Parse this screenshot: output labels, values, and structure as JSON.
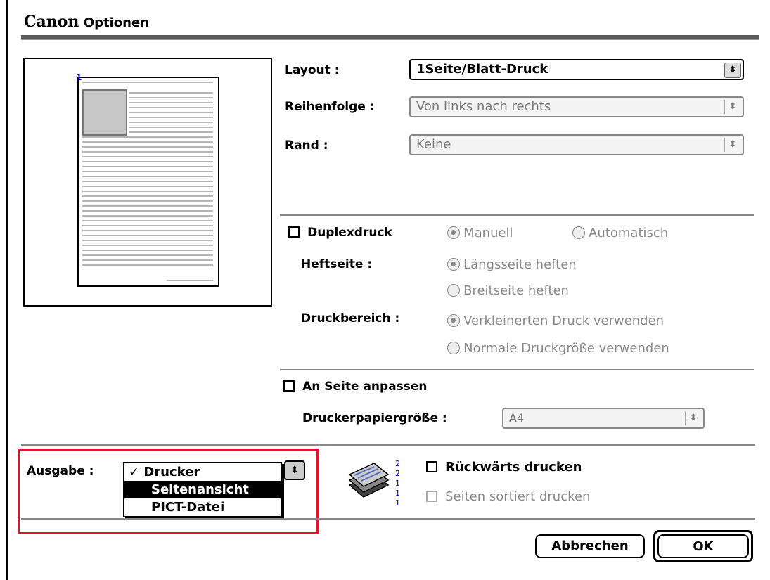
{
  "window": {
    "brand": "Canon",
    "title": "Optionen"
  },
  "layout": {
    "layout_label": "Layout :",
    "layout_value": "1Seite/Blatt-Druck",
    "order_label": "Reihenfolge :",
    "order_value": "Von links nach rechts",
    "border_label": "Rand :",
    "border_value": "Keine",
    "preview_page_number": "1"
  },
  "duplex": {
    "checkbox_label": "Duplexdruck",
    "mode_manual": "Manuell",
    "mode_auto": "Automatisch",
    "binding_label": "Heftseite :",
    "binding_long": "Längsseite heften",
    "binding_short": "Breitseite heften",
    "area_label": "Druckbereich :",
    "area_reduced": "Verkleinerten Druck verwenden",
    "area_normal": "Normale Druckgröße verwenden"
  },
  "fit": {
    "checkbox_label": "An Seite anpassen",
    "paper_label": "Druckerpapiergröße :",
    "paper_value": "A4"
  },
  "output": {
    "label": "Ausgabe :",
    "options": [
      "✓ Drucker",
      "Seitenansicht",
      "PICT-Datei"
    ],
    "reverse_label": "Rückwärts drucken",
    "collate_label": "Seiten sortiert drucken"
  },
  "buttons": {
    "cancel": "Abbrechen",
    "ok": "OK"
  }
}
